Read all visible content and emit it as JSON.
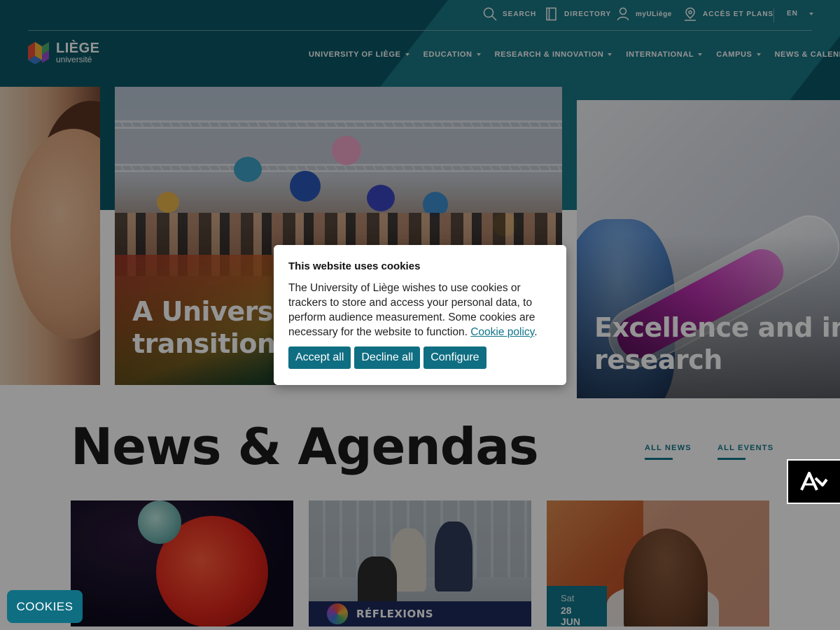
{
  "topbar": {
    "search": "SEARCH",
    "directory": "DIRECTORY",
    "myuliege": "myULiège",
    "access": "ACCÈS ET PLANS",
    "lang": "EN"
  },
  "logo": {
    "line1": "LIÈGE",
    "line2": "université"
  },
  "nav": [
    "UNIVERSITY OF LIÈGE",
    "EDUCATION",
    "RESEARCH & INNOVATION",
    "INTERNATIONAL",
    "CAMPUS",
    "NEWS & CALENDAR"
  ],
  "hero": {
    "center_title_l1": "A University",
    "center_title_l2": "transition",
    "right_title_l1": "Excellence and innov",
    "right_title_l2": "research"
  },
  "news": {
    "title": "News & Agendas",
    "all_news": "ALL NEWS",
    "all_events": "ALL EVENTS",
    "card2_banner": "RÉFLEXIONS",
    "card3_day": "Sat",
    "card3_date": "28 JUN"
  },
  "cookie": {
    "title": "This website uses cookies",
    "body": "The University of Liège wishes to use cookies or trackers to store and access your personal data, to perform audience measurement. Some cookies are necessary for the website to function.",
    "policy_link": "Cookie policy",
    "period": ".",
    "accept": "Accept all",
    "decline": "Decline all",
    "configure": "Configure"
  },
  "cookies_tab": "COOKIES",
  "colors": {
    "header": "#0b5866",
    "accent": "#0f6e82",
    "text": "#1b1b1b"
  }
}
